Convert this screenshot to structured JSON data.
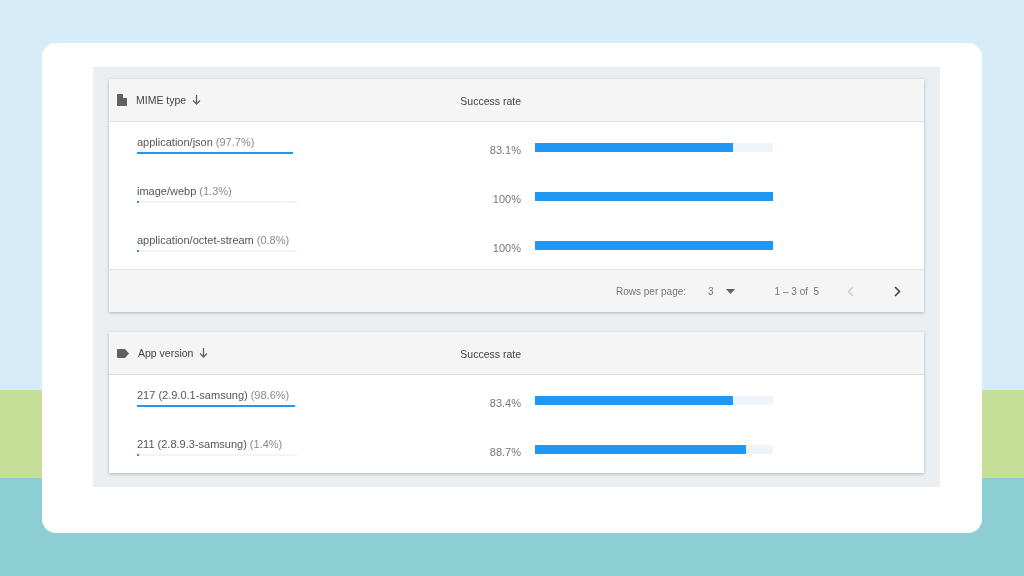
{
  "tables": [
    {
      "kind": "file",
      "column_1": "MIME type",
      "column_2": "Success rate",
      "rows": [
        {
          "name": "application/json",
          "share": "(97.7%)",
          "share_bar": {
            "level": 0.977
          },
          "rate": "83.1%",
          "level": 0.831
        },
        {
          "name": "image/webp",
          "share": "(1.3%)",
          "share_bar": {
            "level": 0.013
          },
          "rate": "100%",
          "level": 1
        },
        {
          "name": "application/octet-stream",
          "share": "(0.8%)",
          "share_bar": {
            "level": 0.008
          },
          "rate": "100%",
          "level": 1
        }
      ],
      "footer": {
        "rows_label": "Rows per page:",
        "rows_value": "3",
        "range": "1 – 3 of  5",
        "prev_disabled": true,
        "next_disabled": false
      }
    },
    {
      "kind": "tag",
      "column_1": "App version",
      "column_2": "Success rate",
      "rows": [
        {
          "name": "217 (2.9.0.1-samsung)",
          "share": "(98.6%)",
          "share_bar": {
            "level": 0.986
          },
          "rate": "83.4%",
          "level": 0.834
        },
        {
          "name": "211 (2.8.9.3-samsung)",
          "share": "(1.4%)",
          "share_bar": {
            "level": 0.014
          },
          "rate": "88.7%",
          "level": 0.887
        }
      ]
    }
  ]
}
